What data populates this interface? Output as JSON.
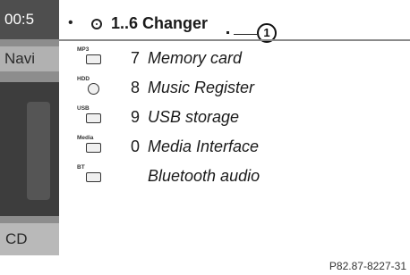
{
  "status": {
    "time": "00:5"
  },
  "sidebar": {
    "nav_label": "Navi",
    "source_label": "CD"
  },
  "menu": {
    "bullet": "•",
    "current": "1..6 Changer",
    "callout": "1",
    "items": [
      {
        "icon": "MP3",
        "number": "7",
        "label": "Memory card"
      },
      {
        "icon": "HDD",
        "number": "8",
        "label": "Music Register"
      },
      {
        "icon": "USB",
        "number": "9",
        "label": "USB storage"
      },
      {
        "icon": "Media",
        "number": "0",
        "label": "Media Interface"
      },
      {
        "icon": "BT",
        "number": "",
        "label": "Bluetooth audio"
      }
    ]
  },
  "figure_ref": "P82.87-8227-31"
}
